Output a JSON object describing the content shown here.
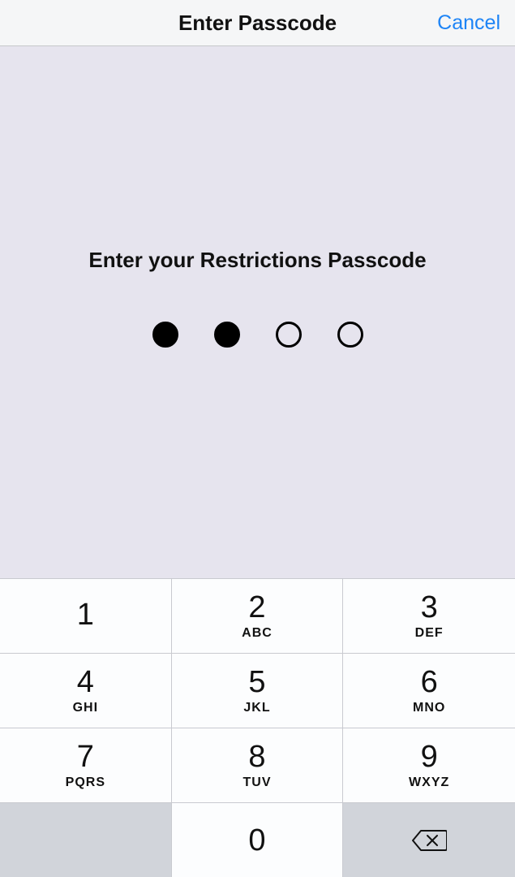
{
  "header": {
    "title": "Enter Passcode",
    "cancel": "Cancel"
  },
  "prompt": "Enter your Restrictions Passcode",
  "passcode": {
    "length": 4,
    "entered": 2
  },
  "keypad": {
    "keys": [
      {
        "digit": "1",
        "letters": ""
      },
      {
        "digit": "2",
        "letters": "ABC"
      },
      {
        "digit": "3",
        "letters": "DEF"
      },
      {
        "digit": "4",
        "letters": "GHI"
      },
      {
        "digit": "5",
        "letters": "JKL"
      },
      {
        "digit": "6",
        "letters": "MNO"
      },
      {
        "digit": "7",
        "letters": "PQRS"
      },
      {
        "digit": "8",
        "letters": "TUV"
      },
      {
        "digit": "9",
        "letters": "WXYZ"
      },
      {
        "digit": "0",
        "letters": ""
      }
    ]
  }
}
